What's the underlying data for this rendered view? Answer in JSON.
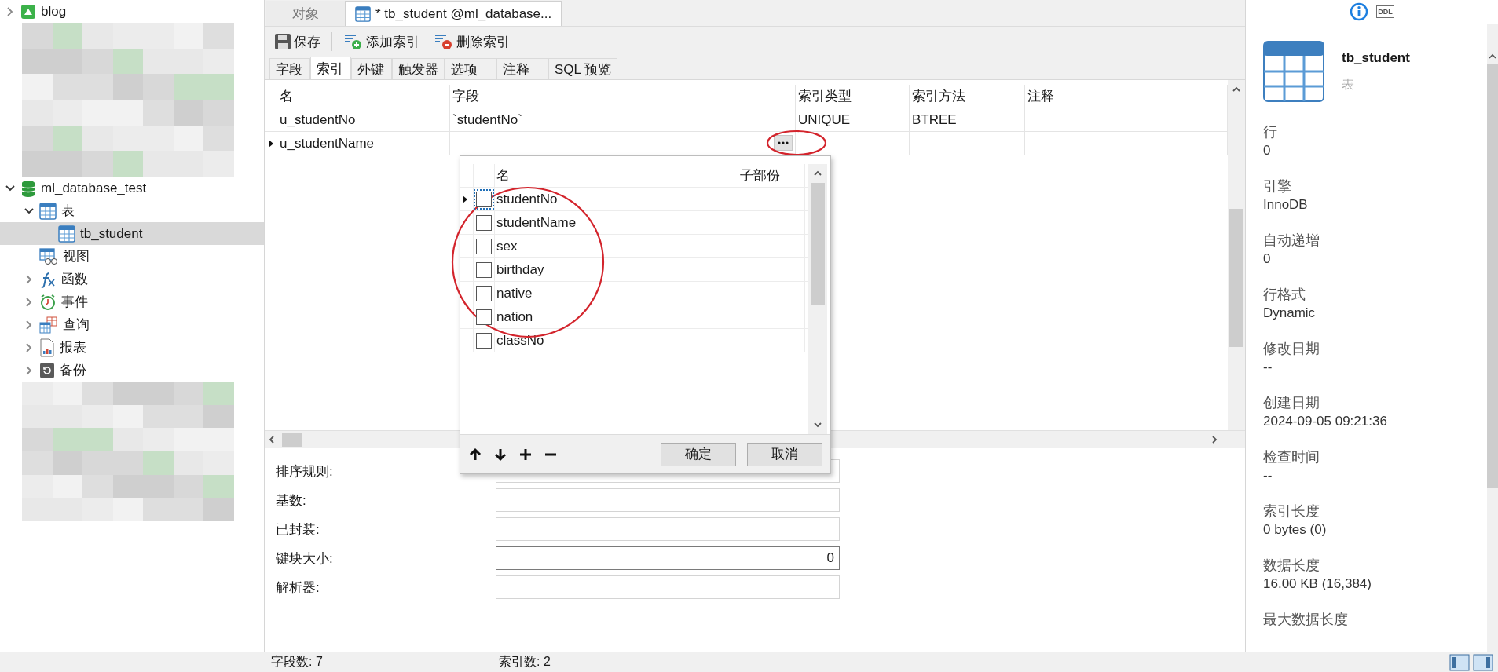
{
  "sidebar": {
    "tree": [
      {
        "label": "blog",
        "kind": "connection",
        "expanded": false,
        "selected": false
      },
      {
        "kind": "redacted"
      },
      {
        "label": "ml_database_test",
        "kind": "database",
        "expanded": true,
        "selected": false,
        "children": [
          {
            "label": "表",
            "kind": "tables",
            "expanded": true,
            "selected": false,
            "children": [
              {
                "label": "tb_student",
                "kind": "table",
                "selected": true
              }
            ]
          },
          {
            "label": "视图",
            "kind": "views",
            "selected": false
          },
          {
            "label": "函数",
            "kind": "functions",
            "expanded": false,
            "selected": false
          },
          {
            "label": "事件",
            "kind": "events",
            "expanded": false,
            "selected": false
          },
          {
            "label": "查询",
            "kind": "queries",
            "expanded": false,
            "selected": false
          },
          {
            "label": "报表",
            "kind": "reports",
            "expanded": false,
            "selected": false
          },
          {
            "label": "备份",
            "kind": "backups",
            "expanded": false,
            "selected": false
          }
        ]
      },
      {
        "kind": "redacted"
      }
    ]
  },
  "tabs": [
    {
      "label": "对象",
      "selected": false
    },
    {
      "label": "* tb_student @ml_database...",
      "selected": true
    }
  ],
  "toolbar": [
    {
      "label": "保存",
      "kind": "save"
    },
    {
      "label": "添加索引",
      "kind": "add"
    },
    {
      "label": "删除索引",
      "kind": "delete"
    }
  ],
  "subtabs": [
    {
      "label": "字段",
      "selected": false
    },
    {
      "label": "索引",
      "selected": true
    },
    {
      "label": "外键",
      "selected": false
    },
    {
      "label": "触发器",
      "selected": false
    },
    {
      "label": "选项",
      "selected": false
    },
    {
      "label": "注释",
      "selected": false
    },
    {
      "label": "SQL 预览",
      "selected": false
    }
  ],
  "table": {
    "columns": [
      "名",
      "字段",
      "索引类型",
      "索引方法",
      "注释"
    ],
    "rows": [
      {
        "selected": false,
        "editing": false,
        "cells": [
          "u_studentNo",
          "`studentNo`",
          "UNIQUE",
          "BTREE",
          ""
        ]
      },
      {
        "selected": true,
        "editing": true,
        "cells": [
          "u_studentName",
          "",
          "",
          "",
          ""
        ]
      }
    ]
  },
  "field_picker": {
    "columns": [
      "名",
      "子部份"
    ],
    "rows": [
      {
        "name": "studentNo",
        "checked": false,
        "selected": true
      },
      {
        "name": "studentName",
        "checked": false,
        "selected": false
      },
      {
        "name": "sex",
        "checked": false,
        "selected": false
      },
      {
        "name": "birthday",
        "checked": false,
        "selected": false
      },
      {
        "name": "native",
        "checked": false,
        "selected": false
      },
      {
        "name": "nation",
        "checked": false,
        "selected": false
      },
      {
        "name": "classNo",
        "checked": false,
        "selected": false
      }
    ],
    "buttons": [
      "确定",
      "取消"
    ]
  },
  "form": [
    {
      "label": "排序规则:"
    },
    {
      "label": "基数:"
    },
    {
      "label": "已封装:"
    },
    {
      "label": "键块大小:",
      "value": "0",
      "focused": true
    },
    {
      "label": "解析器:"
    }
  ],
  "status_bar": [
    "字段数: 7",
    "索引数: 2"
  ],
  "info_panel": {
    "tabs": [
      {
        "kind": "info",
        "selected": true
      },
      {
        "kind": "ddl",
        "label": "DDL",
        "selected": false
      }
    ],
    "name": "tb_student",
    "type": "表",
    "properties": [
      {
        "label": "行",
        "value": "0"
      },
      {
        "label": "引擎",
        "value": "InnoDB"
      },
      {
        "label": "自动递增",
        "value": "0"
      },
      {
        "label": "行格式",
        "value": "Dynamic"
      },
      {
        "label": "修改日期",
        "value": "--"
      },
      {
        "label": "创建日期",
        "value": "2024-09-05 09:21:36"
      },
      {
        "label": "检查时间",
        "value": "--"
      },
      {
        "label": "索引长度",
        "value": "0 bytes (0)"
      },
      {
        "label": "数据长度",
        "value": "16.00 KB (16,384)"
      },
      {
        "label": "最大数据长度"
      }
    ]
  }
}
